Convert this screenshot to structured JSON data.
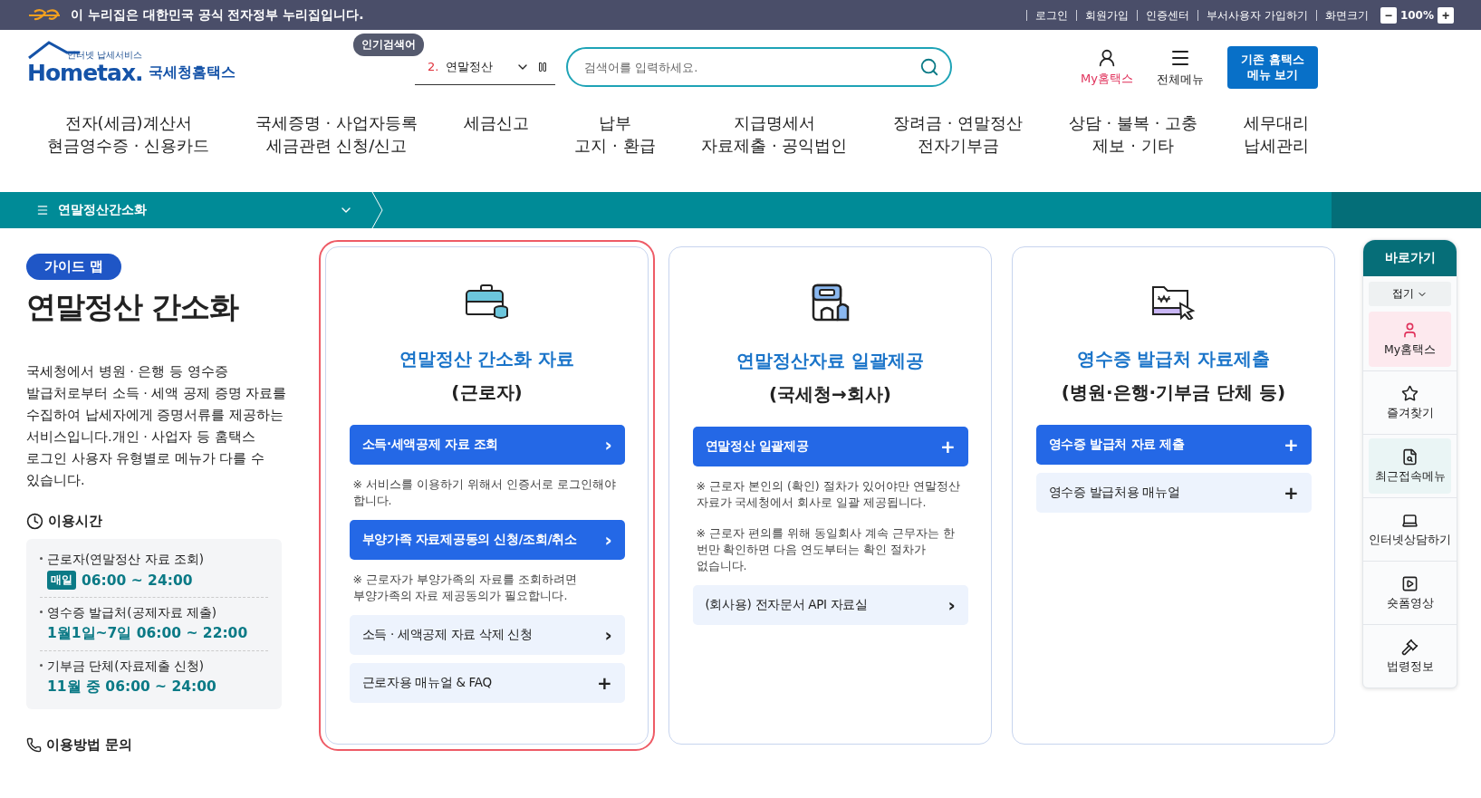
{
  "gov_banner": {
    "text": "이 누리집은 대한민국 공식 전자정부 누리집입니다.",
    "links": [
      "로그인",
      "회원가입",
      "인증센터",
      "부서사용자 가입하기"
    ],
    "zoom_label": "화면크기",
    "zoom_out": "−",
    "zoom_value": "100%",
    "zoom_in": "+"
  },
  "header": {
    "logo_tagline": "인터넷 납세서비스",
    "logo_text": "Hometax.",
    "logo_name": "국세청홈택스",
    "popular_label": "인기검색어",
    "popular_rank": "2.",
    "popular_keyword": "연말정산",
    "search": {
      "placeholder": "검색어를 입력하세요."
    },
    "my_hometax": "My홈택스",
    "all_menu": "전체메뉴",
    "classic_button": [
      "기존 홈택스",
      "메뉴 보기"
    ]
  },
  "nav": [
    {
      "lines": [
        "전자(세금)계산서",
        "현금영수증 · 신용카드"
      ]
    },
    {
      "lines": [
        "국세증명 · 사업자등록",
        "세금관련 신청/신고"
      ]
    },
    {
      "lines": [
        "세금신고"
      ]
    },
    {
      "lines": [
        "납부",
        "고지 · 환급"
      ]
    },
    {
      "lines": [
        "지급명세서",
        "자료제출 · 공익법인"
      ]
    },
    {
      "lines": [
        "장려금 · 연말정산",
        "전자기부금"
      ]
    },
    {
      "lines": [
        "상담 · 불복 · 고충",
        "제보 · 기타"
      ]
    },
    {
      "lines": [
        "세무대리",
        "납세관리"
      ]
    }
  ],
  "breadcrumb": {
    "label": "연말정산간소화"
  },
  "guide": {
    "badge": "가이드 맵",
    "title": "연말정산 간소화",
    "description": "국세청에서 병원 · 은행 등 영수증 발급처로부터 소득 · 세액 공제 증명 자료를 수집하여 납세자에게 증명서류를 제공하는 서비스입니다.개인 · 사업자 등 홈택스 로그인 사용자 유형별로 메뉴가 다를 수 있습니다.",
    "hours_title": "이용시간",
    "hours": [
      {
        "label": "근로자(연말정산 자료 조회)",
        "tag": "매일",
        "time": "06:00 ~ 24:00"
      },
      {
        "label": "영수증 발급처(공제자료 제출)",
        "time": "1월1일~7일 06:00 ~ 22:00"
      },
      {
        "label": "기부금 단체(자료제출 신청)",
        "time": "11월 중 06:00 ~ 24:00"
      }
    ],
    "contact_title": "이용방법 문의"
  },
  "cards": [
    {
      "title": "연말정산 간소화 자료",
      "subtitle": "(근로자)",
      "highlighted": true,
      "items": [
        {
          "kind": "primary",
          "label": "소득·세액공제 자료 조회",
          "symbol": "›"
        },
        {
          "kind": "note",
          "text": "※ 서비스를 이용하기 위해서 인증서로 로그인해야 합니다."
        },
        {
          "kind": "primary",
          "label": "부양가족 자료제공동의 신청/조회/취소",
          "symbol": "›"
        },
        {
          "kind": "note",
          "text": "※ 근로자가 부양가족의 자료를 조회하려면 부양가족의 자료 제공동의가 필요합니다."
        },
        {
          "kind": "secondary",
          "label": "소득 · 세액공제 자료 삭제 신청",
          "symbol": "›"
        },
        {
          "kind": "secondary",
          "label": "근로자용 매뉴얼 & FAQ",
          "symbol": "+"
        }
      ]
    },
    {
      "title": "연말정산자료 일괄제공",
      "subtitle": "(국세청→회사)",
      "highlighted": false,
      "items": [
        {
          "kind": "primary",
          "label": "연말정산 일괄제공",
          "symbol": "+"
        },
        {
          "kind": "note",
          "text": "※ 근로자 본인의 (확인) 절차가 있어야만 연말정산 자료가 국세청에서 회사로 일괄 제공됩니다."
        },
        {
          "kind": "note",
          "text": "※ 근로자 편의를 위해 동일회사 계속 근무자는 한 번만 확인하면 다음 연도부터는 확인 절차가 없습니다."
        },
        {
          "kind": "secondary",
          "label": "(회사용) 전자문서 API 자료실",
          "symbol": "›"
        }
      ]
    },
    {
      "title": "영수증 발급처 자료제출",
      "subtitle": "(병원·은행·기부금 단체 등)",
      "highlighted": false,
      "items": [
        {
          "kind": "primary",
          "label": "영수증 발급처 자료 제출",
          "symbol": "+"
        },
        {
          "kind": "secondary",
          "label": "영수증 발급처용 매뉴얼",
          "symbol": "+"
        }
      ]
    }
  ],
  "quick_menu": {
    "title": "바로가기",
    "fold": "접기",
    "items": [
      {
        "label": "My홈택스",
        "color": "#fde9ee"
      },
      {
        "label": "즐겨찾기"
      },
      {
        "label": "최근접속메뉴",
        "color": "#eaf5f5"
      },
      {
        "label": "인터넷상담하기"
      },
      {
        "label": "숏폼영상"
      },
      {
        "label": "법령정보"
      }
    ]
  }
}
